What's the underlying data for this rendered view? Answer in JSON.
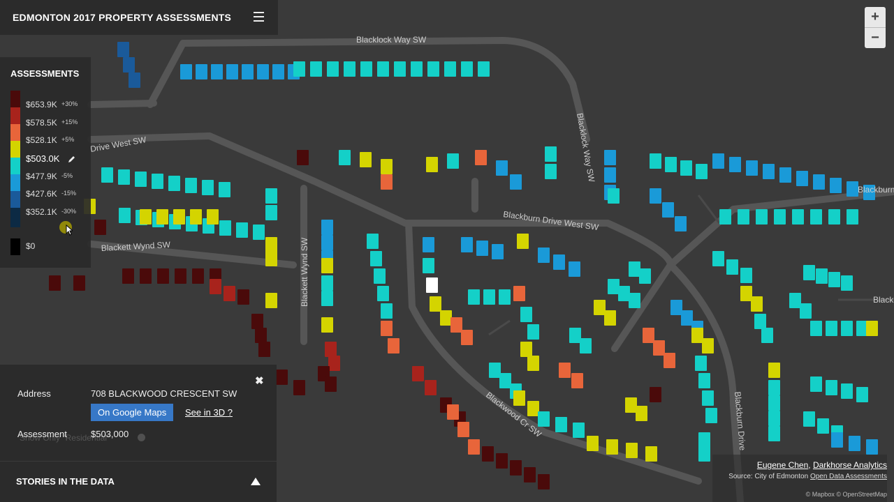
{
  "header": {
    "title": "EDMONTON 2017 PROPERTY ASSESSMENTS"
  },
  "legend": {
    "title": "ASSESSMENTS",
    "entries": [
      {
        "value": "$653.9K",
        "pct": "+30%"
      },
      {
        "value": "$578.5K",
        "pct": "+15%"
      },
      {
        "value": "$528.1K",
        "pct": "+5%"
      },
      {
        "value": "$503.0K",
        "pct": ""
      },
      {
        "value": "$477.9K",
        "pct": "-5%"
      },
      {
        "value": "$427.6K",
        "pct": "-15%"
      },
      {
        "value": "$352.1K",
        "pct": "-30%"
      },
      {
        "value": "$0",
        "pct": ""
      }
    ],
    "colors": [
      "#4a0a0a",
      "#a8231c",
      "#e8653a",
      "#d4d400",
      "#14d0c8",
      "#1a9ad8",
      "#1a5a9a",
      "#0c2a44",
      "#000000"
    ]
  },
  "streets": [
    "Blacklock Way SW",
    "Drive West SW",
    "Blackburn Drive West SW",
    "Blackett Wynd SW",
    "Blackett Wynd SW",
    "Blacklock Way SW",
    "Blackwood Cr SW",
    "Blackburn Drive",
    "Blackburn",
    "Black"
  ],
  "info": {
    "address_label": "Address",
    "address_value": "708 BLACKWOOD CRESCENT SW",
    "google_maps_label": "On Google Maps",
    "see3d_label": "See in 3D",
    "assessment_label": "Assessment",
    "assessment_value": "$503,000",
    "residential_toggle_label": "Show Only \"Residential\""
  },
  "stories": {
    "label": "STORIES IN THE DATA"
  },
  "zoom": {
    "in_label": "+",
    "out_label": "−"
  },
  "attribution": {
    "author": "Eugene Chen",
    "company": "Darkhorse Analytics",
    "source_prefix": "Source: City of Edmonton ",
    "source_link": "Open Data Assessments",
    "map_credit": "© Mapbox © OpenStreetMap"
  },
  "selected_marker_color": "#ffffff"
}
